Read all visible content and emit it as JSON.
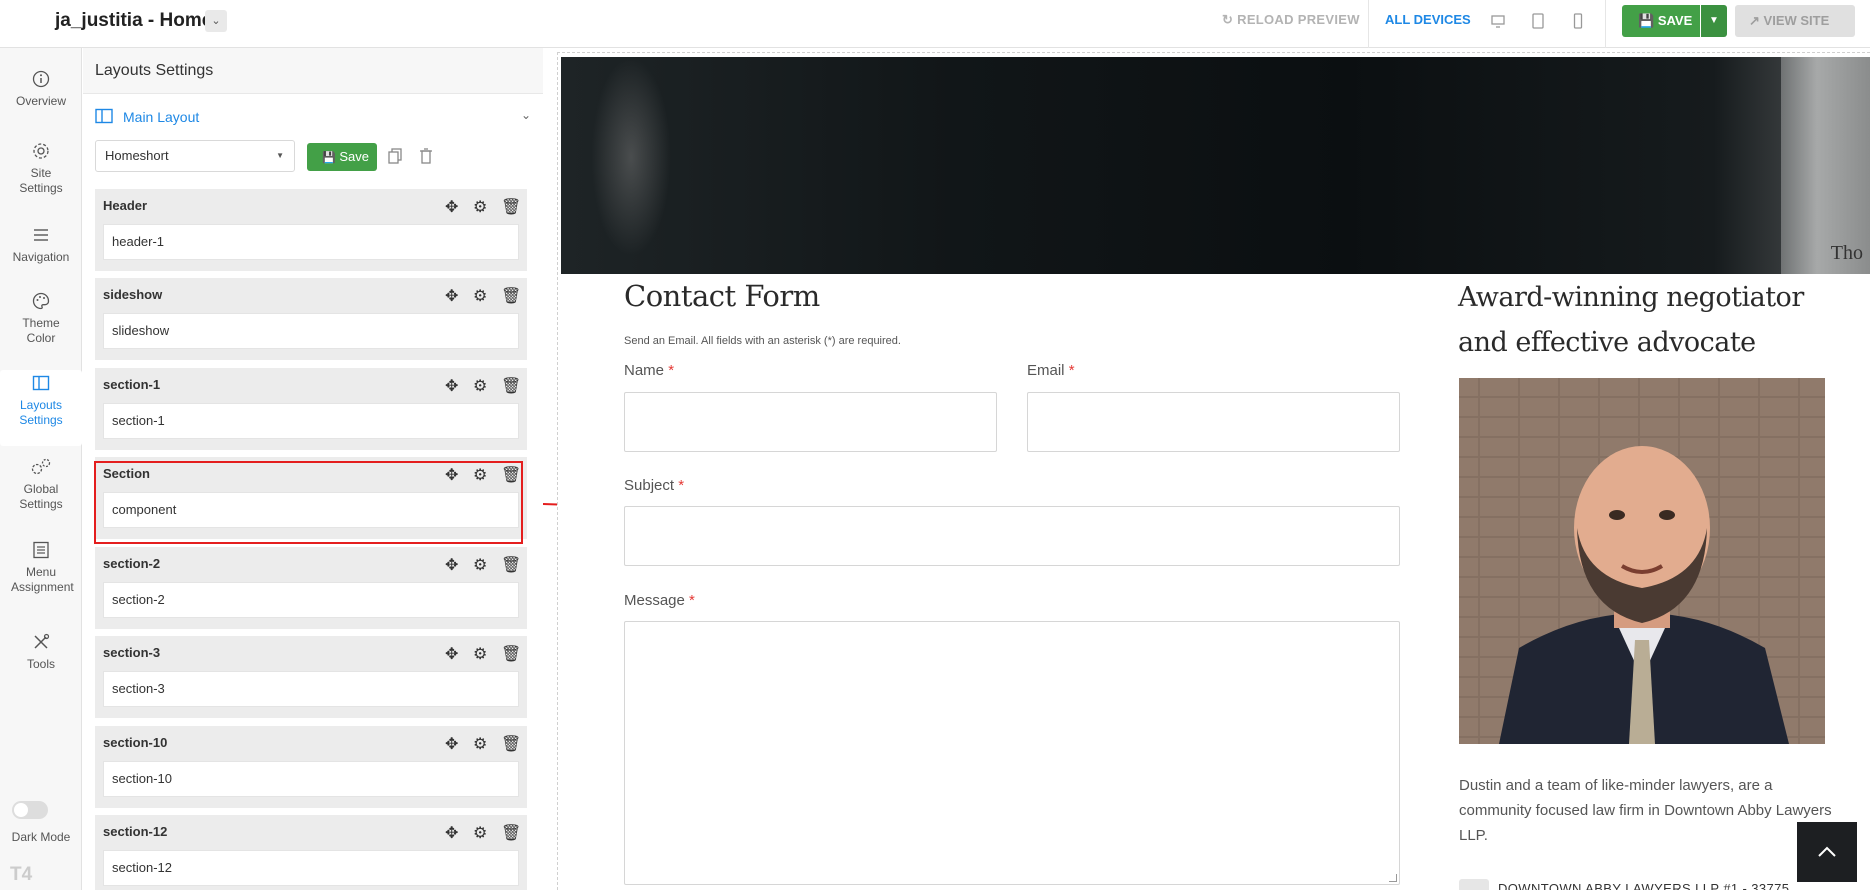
{
  "app": {
    "site_title": "ja_justitia - Home",
    "reload_label": "RELOAD PREVIEW",
    "devices_label": "ALL DEVICES",
    "save_label": "SAVE",
    "view_site_label": "VIEW SITE"
  },
  "nav": {
    "items": [
      {
        "label": "Overview",
        "icon": "info-icon"
      },
      {
        "label": "Site Settings",
        "icon": "gear-icon"
      },
      {
        "label": "Navigation",
        "icon": "menu-icon"
      },
      {
        "label": "Theme Color",
        "icon": "palette-icon"
      },
      {
        "label": "Layouts Settings",
        "icon": "layout-icon",
        "active": true
      },
      {
        "label": "Global Settings",
        "icon": "gears-icon"
      },
      {
        "label": "Menu Assignment",
        "icon": "list-icon"
      },
      {
        "label": "Tools",
        "icon": "tools-icon"
      }
    ],
    "dark_mode_label": "Dark Mode",
    "logo_text": "T4"
  },
  "panel": {
    "title": "Layouts Settings",
    "main_layout_label": "Main Layout",
    "layout_select_value": "Homeshort",
    "save_label": "Save",
    "sections": [
      {
        "name": "Header",
        "value": "header-1"
      },
      {
        "name": "sideshow",
        "value": "slideshow"
      },
      {
        "name": "section-1",
        "value": "section-1"
      },
      {
        "name": "Section",
        "value": "component"
      },
      {
        "name": "section-2",
        "value": "section-2"
      },
      {
        "name": "section-3",
        "value": "section-3"
      },
      {
        "name": "section-10",
        "value": "section-10"
      },
      {
        "name": "section-12",
        "value": "section-12"
      }
    ]
  },
  "preview": {
    "hero_text": "Tho",
    "contact_title": "Contact Form",
    "contact_subtitle": "Send an Email. All fields with an asterisk (*) are required.",
    "name_label": "Name",
    "email_label": "Email",
    "subject_label": "Subject",
    "message_label": "Message",
    "required_mark": "*",
    "award_title": "Award-winning negotiator and effective advocate",
    "award_desc": "Dustin and a team of like-minder lawyers, are a community focused law firm in Downtown Abby Lawyers LLP.",
    "address_partial": "DOWNTOWN ABBY LAWYERS LLP #1 - 33775"
  },
  "colors": {
    "accent": "#1e88e5",
    "save_green": "#43a047",
    "highlight_red": "#e41e1e"
  }
}
